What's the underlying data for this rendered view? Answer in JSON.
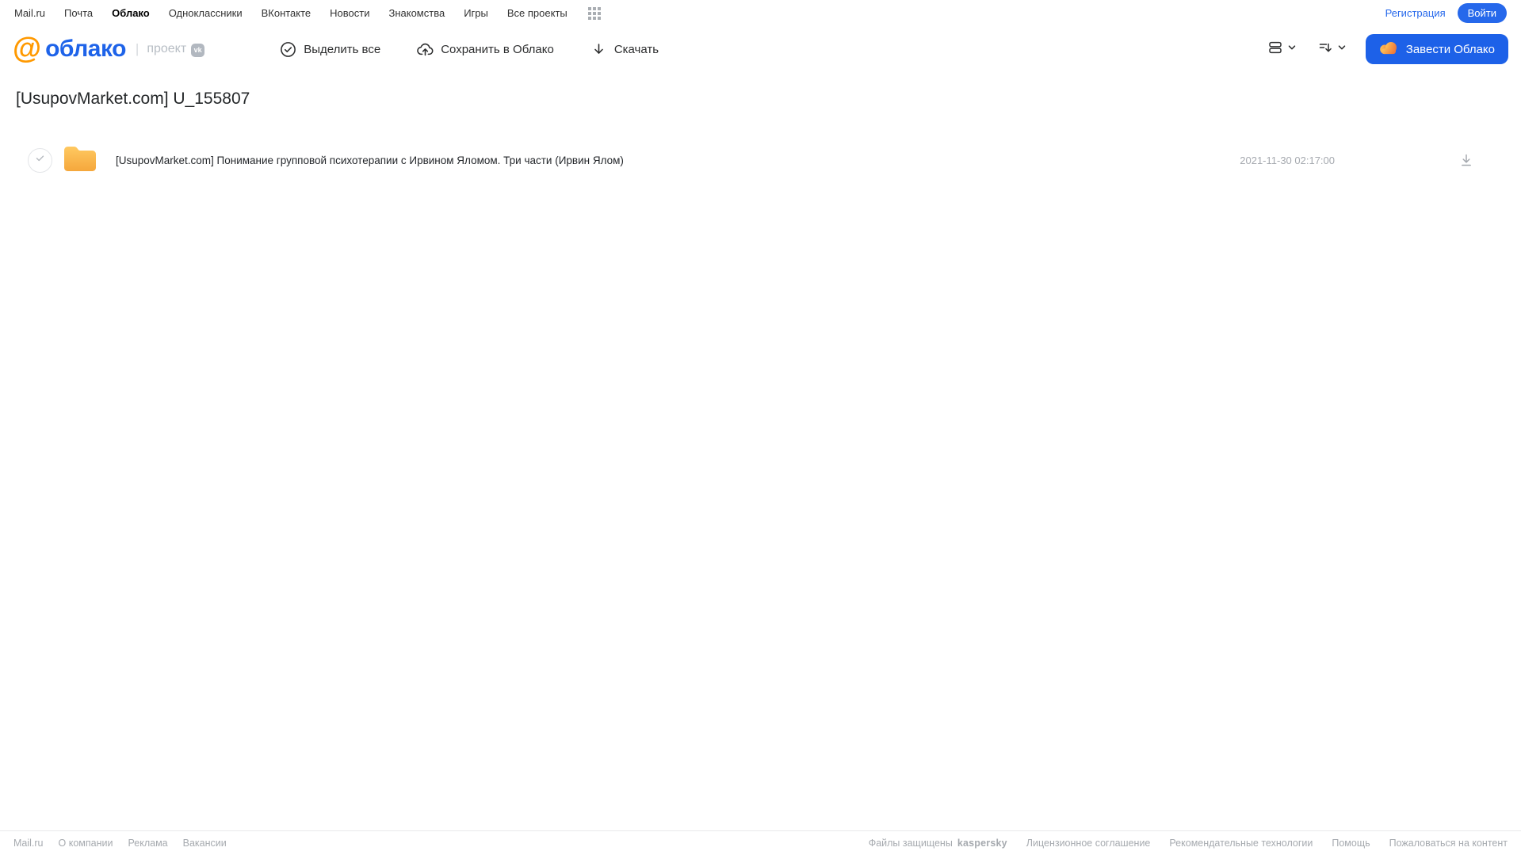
{
  "top_nav": {
    "items": [
      "Mail.ru",
      "Почта",
      "Облако",
      "Одноклассники",
      "ВКонтакте",
      "Новости",
      "Знакомства",
      "Игры",
      "Все проекты"
    ],
    "active_item": "Облако",
    "registration_label": "Регистрация",
    "login_label": "Войти"
  },
  "toolbar": {
    "logo_at": "@",
    "logo_text": "облако",
    "logo_separator": "|",
    "project_label": "проект",
    "vk_badge": "vk",
    "select_all_label": "Выделить все",
    "save_to_cloud_label": "Сохранить в Облако",
    "download_label": "Скачать",
    "get_cloud_label": "Завести Облако"
  },
  "main": {
    "title": "[UsupovMarket.com] U_155807",
    "files": [
      {
        "name": "[UsupovMarket.com] Понимание групповой психотерапии с Ирвином Яломом. Три части (Ирвин Ялом)",
        "date": "2021-11-30 02:17:00",
        "type": "folder"
      }
    ]
  },
  "footer": {
    "left_links": [
      "Mail.ru",
      "О компании",
      "Реклама",
      "Вакансии"
    ],
    "protected_label": "Файлы защищены",
    "kaspersky_label": "kaspersky",
    "right_links": [
      "Лицензионное соглашение",
      "Рекомендательные технологии",
      "Помощь",
      "Пожаловаться на контент"
    ]
  },
  "icons": [
    "apps-grid-icon",
    "circle-check-icon",
    "cloud-upload-icon",
    "download-arrow-icon",
    "view-toggle-icon",
    "sort-icon",
    "chevron-down-icon",
    "cloud-icon",
    "folder-icon",
    "download-underline-icon",
    "vk-badge-icon",
    "at-logo-icon",
    "checkmark-icon"
  ],
  "colors": {
    "accent_blue": "#1D61E8",
    "link_blue": "#2668EB",
    "logo_orange": "#FF9900",
    "kaspersky_teal": "#00A88E",
    "folder_top": "#FFC961",
    "folder_bottom": "#F5A73C",
    "muted_gray": "#A5A9AF"
  }
}
